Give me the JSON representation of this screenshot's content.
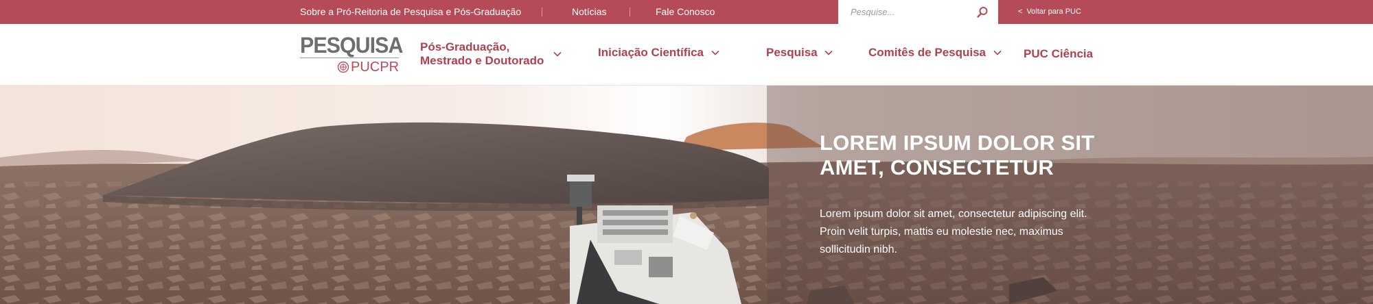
{
  "topbar": {
    "links": [
      "Sobre a Pró-Reitoria de Pesquisa e Pós-Graduação",
      "Notícias",
      "Fale Conosco"
    ],
    "search_placeholder": "Pesquise...",
    "back_label": "Voltar para PUC",
    "color": "#b54b59"
  },
  "logo": {
    "word": "PESQUISA",
    "sub": "PUCPR"
  },
  "nav": {
    "items": [
      {
        "label": "Pós-Graduação,\nMestrado e Doutorado",
        "dropdown": true
      },
      {
        "label": "Iniciação Científica",
        "dropdown": true
      },
      {
        "label": "Pesquisa",
        "dropdown": true
      },
      {
        "label": "Comitês de Pesquisa",
        "dropdown": true
      },
      {
        "label": "PUC Ciência",
        "dropdown": false
      }
    ],
    "color": "#b0404f"
  },
  "hero": {
    "title": "LOREM IPSUM DOLOR SIT AMET, CONSECTETUR",
    "text": "Lorem ipsum dolor sit amet, consectetur adipiscing elit. Proin velit turpis, mattis eu molestie nec, maximus sollicitudin nibh."
  },
  "icons": {
    "search": "search-icon",
    "back": "chevron-left-icon",
    "caret": "chevron-down-icon",
    "seal": "university-seal-icon"
  }
}
